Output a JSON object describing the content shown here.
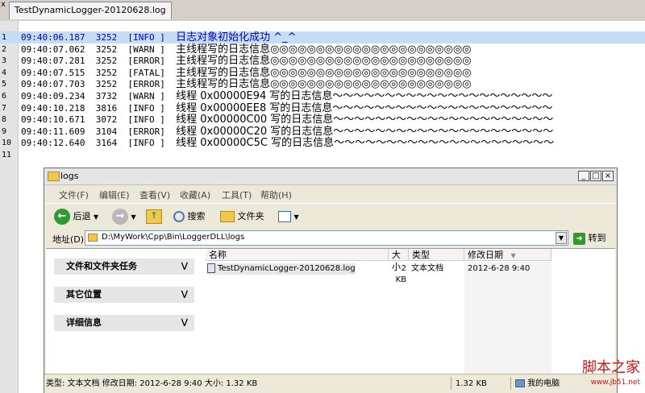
{
  "editor": {
    "tab_title": "TestDynamicLogger-20120628.log",
    "close_glyph": "x",
    "lines": [
      {
        "num": "1",
        "time": "09:40:06.187",
        "tid": "3252",
        "level": "[INFO ]",
        "msg": "日志对象初始化成功 ^_^"
      },
      {
        "num": "2",
        "time": "09:40:07.062",
        "tid": "3252",
        "level": "[WARN ]",
        "msg": "主线程写的日志信息◎◎◎◎◎◎◎◎◎◎◎◎◎◎◎◎◎◎◎◎◎◎"
      },
      {
        "num": "3",
        "time": "09:40:07.281",
        "tid": "3252",
        "level": "[ERROR]",
        "msg": "主线程写的日志信息◎◎◎◎◎◎◎◎◎◎◎◎◎◎◎◎◎◎◎◎◎◎"
      },
      {
        "num": "4",
        "time": "09:40:07.515",
        "tid": "3252",
        "level": "[FATAL]",
        "msg": "主线程写的日志信息◎◎◎◎◎◎◎◎◎◎◎◎◎◎◎◎◎◎◎◎◎◎"
      },
      {
        "num": "5",
        "time": "09:40:07.703",
        "tid": "3252",
        "level": "[ERROR]",
        "msg": "主线程写的日志信息◎◎◎◎◎◎◎◎◎◎◎◎◎◎◎◎◎◎◎◎◎◎"
      },
      {
        "num": "6",
        "time": "09:40:09.234",
        "tid": "3732",
        "level": "[WARN ]",
        "msg": "线程 0x00000E94 写的日志信息～～～～～～～～～～～～～～～～～～～～～"
      },
      {
        "num": "7",
        "time": "09:40:10.218",
        "tid": "3816",
        "level": "[INFO ]",
        "msg": "线程 0x00000EE8 写的日志信息～～～～～～～～～～～～～～～～～～～～～"
      },
      {
        "num": "8",
        "time": "09:40:10.671",
        "tid": "3072",
        "level": "[INFO ]",
        "msg": "线程 0x00000C00 写的日志信息～～～～～～～～～～～～～～～～～～～～～"
      },
      {
        "num": "9",
        "time": "09:40:11.609",
        "tid": "3104",
        "level": "[ERROR]",
        "msg": "线程 0x00000C20 写的日志信息～～～～～～～～～～～～～～～～～～～～～"
      },
      {
        "num": "10",
        "time": "09:40:12.640",
        "tid": "3164",
        "level": "[INFO ]",
        "msg": "线程 0x00000C5C 写的日志信息～～～～～～～～～～～～～～～～～～～～～"
      },
      {
        "num": "11",
        "time": "",
        "tid": "",
        "level": "",
        "msg": ""
      }
    ]
  },
  "explorer": {
    "title": "logs",
    "window_buttons": {
      "minimize": "_",
      "maximize": "□",
      "close": "×"
    },
    "menu": [
      "文件(F)",
      "编辑(E)",
      "查看(V)",
      "收藏(A)",
      "工具(T)",
      "帮助(H)"
    ],
    "toolbar": {
      "back": "后退",
      "search": "搜索",
      "folders": "文件夹"
    },
    "address": {
      "label": "地址(D)",
      "path": "D:\\MyWork\\Cpp\\Bin\\LoggerDLL\\logs",
      "go": "转到"
    },
    "task_panels": [
      "文件和文件夹任务",
      "其它位置",
      "详细信息"
    ],
    "columns": [
      "名称",
      "大小",
      "类型",
      "修改日期"
    ],
    "files": [
      {
        "name": "TestDynamicLogger-20120628.log",
        "size": "2 KB",
        "type": "文本文档",
        "modified": "2012-6-28 9:40"
      }
    ],
    "status": {
      "left": "类型: 文本文档 修改日期: 2012-6-28 9:40 大小: 1.32 KB",
      "size": "1.32 KB",
      "location": "我的电脑"
    }
  },
  "watermark": {
    "main": "脚本之家",
    "sub": "www.jb51.net"
  },
  "colors": {
    "highlight_line": "#c4def7",
    "accent_text": "#0000c0",
    "watermark": "#c01818"
  }
}
